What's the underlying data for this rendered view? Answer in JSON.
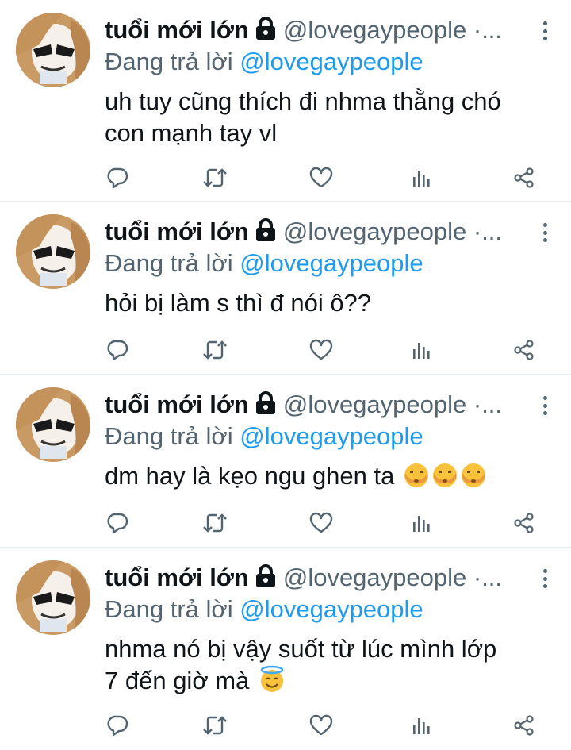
{
  "colors": {
    "name": "#0f1419",
    "secondary": "#536471",
    "mention": "#1d9bf0",
    "divider": "#e6ecf0"
  },
  "tweets": [
    {
      "name": "tuổi mới lớn",
      "handle": "@lovegaypeople ·...",
      "reply_prefix": "Đang trả lời",
      "reply_to": "@lovegaypeople",
      "text_lines": [
        "uh tuy cũng thích đi nhma thằng chó",
        "con mạnh tay vl"
      ],
      "emojis": []
    },
    {
      "name": "tuổi mới lớn",
      "handle": "@lovegaypeople ·...",
      "reply_prefix": "Đang trả lời",
      "reply_to": "@lovegaypeople",
      "text_lines": [
        "hỏi bị làm s thì đ nói ô??"
      ],
      "emojis": []
    },
    {
      "name": "tuổi mới lớn",
      "handle": "@lovegaypeople ·...",
      "reply_prefix": "Đang trả lời",
      "reply_to": "@lovegaypeople",
      "text_lines": [
        "dm hay là kẹo ngu ghen ta"
      ],
      "emojis": [
        "see-no-evil-face-icon",
        "see-no-evil-face-icon",
        "see-no-evil-face-icon"
      ]
    },
    {
      "name": "tuổi mới lớn",
      "handle": "@lovegaypeople ·...",
      "reply_prefix": "Đang trả lời",
      "reply_to": "@lovegaypeople",
      "text_lines": [
        "nhma nó bị vậy suốt từ lúc mình lớp",
        "7 đến giờ mà"
      ],
      "emojis": [
        "smiling-face-with-halo-icon"
      ]
    }
  ],
  "icons": {
    "reply": "reply-icon",
    "retweet": "retweet-icon",
    "like": "heart-icon",
    "views": "views-icon",
    "share": "share-icon",
    "lock": "lock-icon",
    "more": "more-vertical-icon"
  }
}
